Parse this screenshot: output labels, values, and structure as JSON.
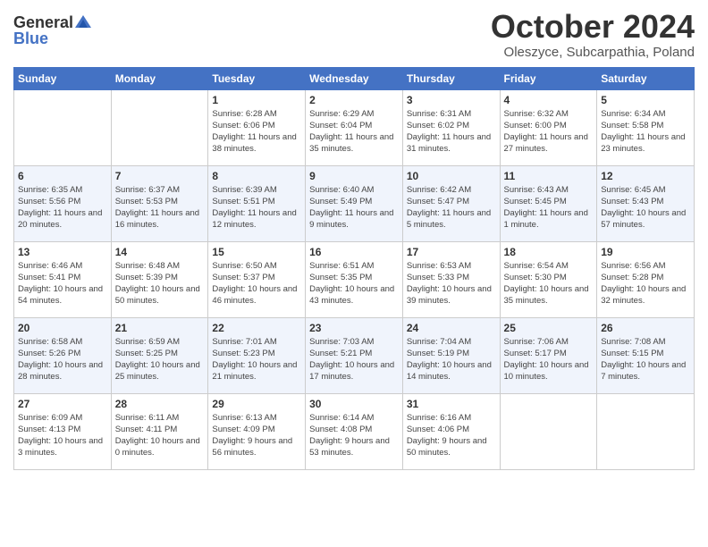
{
  "header": {
    "logo_general": "General",
    "logo_blue": "Blue",
    "month": "October 2024",
    "location": "Oleszyce, Subcarpathia, Poland"
  },
  "days_of_week": [
    "Sunday",
    "Monday",
    "Tuesday",
    "Wednesday",
    "Thursday",
    "Friday",
    "Saturday"
  ],
  "weeks": [
    [
      {
        "day": "",
        "info": ""
      },
      {
        "day": "",
        "info": ""
      },
      {
        "day": "1",
        "info": "Sunrise: 6:28 AM\nSunset: 6:06 PM\nDaylight: 11 hours and 38 minutes."
      },
      {
        "day": "2",
        "info": "Sunrise: 6:29 AM\nSunset: 6:04 PM\nDaylight: 11 hours and 35 minutes."
      },
      {
        "day": "3",
        "info": "Sunrise: 6:31 AM\nSunset: 6:02 PM\nDaylight: 11 hours and 31 minutes."
      },
      {
        "day": "4",
        "info": "Sunrise: 6:32 AM\nSunset: 6:00 PM\nDaylight: 11 hours and 27 minutes."
      },
      {
        "day": "5",
        "info": "Sunrise: 6:34 AM\nSunset: 5:58 PM\nDaylight: 11 hours and 23 minutes."
      }
    ],
    [
      {
        "day": "6",
        "info": "Sunrise: 6:35 AM\nSunset: 5:56 PM\nDaylight: 11 hours and 20 minutes."
      },
      {
        "day": "7",
        "info": "Sunrise: 6:37 AM\nSunset: 5:53 PM\nDaylight: 11 hours and 16 minutes."
      },
      {
        "day": "8",
        "info": "Sunrise: 6:39 AM\nSunset: 5:51 PM\nDaylight: 11 hours and 12 minutes."
      },
      {
        "day": "9",
        "info": "Sunrise: 6:40 AM\nSunset: 5:49 PM\nDaylight: 11 hours and 9 minutes."
      },
      {
        "day": "10",
        "info": "Sunrise: 6:42 AM\nSunset: 5:47 PM\nDaylight: 11 hours and 5 minutes."
      },
      {
        "day": "11",
        "info": "Sunrise: 6:43 AM\nSunset: 5:45 PM\nDaylight: 11 hours and 1 minute."
      },
      {
        "day": "12",
        "info": "Sunrise: 6:45 AM\nSunset: 5:43 PM\nDaylight: 10 hours and 57 minutes."
      }
    ],
    [
      {
        "day": "13",
        "info": "Sunrise: 6:46 AM\nSunset: 5:41 PM\nDaylight: 10 hours and 54 minutes."
      },
      {
        "day": "14",
        "info": "Sunrise: 6:48 AM\nSunset: 5:39 PM\nDaylight: 10 hours and 50 minutes."
      },
      {
        "day": "15",
        "info": "Sunrise: 6:50 AM\nSunset: 5:37 PM\nDaylight: 10 hours and 46 minutes."
      },
      {
        "day": "16",
        "info": "Sunrise: 6:51 AM\nSunset: 5:35 PM\nDaylight: 10 hours and 43 minutes."
      },
      {
        "day": "17",
        "info": "Sunrise: 6:53 AM\nSunset: 5:33 PM\nDaylight: 10 hours and 39 minutes."
      },
      {
        "day": "18",
        "info": "Sunrise: 6:54 AM\nSunset: 5:30 PM\nDaylight: 10 hours and 35 minutes."
      },
      {
        "day": "19",
        "info": "Sunrise: 6:56 AM\nSunset: 5:28 PM\nDaylight: 10 hours and 32 minutes."
      }
    ],
    [
      {
        "day": "20",
        "info": "Sunrise: 6:58 AM\nSunset: 5:26 PM\nDaylight: 10 hours and 28 minutes."
      },
      {
        "day": "21",
        "info": "Sunrise: 6:59 AM\nSunset: 5:25 PM\nDaylight: 10 hours and 25 minutes."
      },
      {
        "day": "22",
        "info": "Sunrise: 7:01 AM\nSunset: 5:23 PM\nDaylight: 10 hours and 21 minutes."
      },
      {
        "day": "23",
        "info": "Sunrise: 7:03 AM\nSunset: 5:21 PM\nDaylight: 10 hours and 17 minutes."
      },
      {
        "day": "24",
        "info": "Sunrise: 7:04 AM\nSunset: 5:19 PM\nDaylight: 10 hours and 14 minutes."
      },
      {
        "day": "25",
        "info": "Sunrise: 7:06 AM\nSunset: 5:17 PM\nDaylight: 10 hours and 10 minutes."
      },
      {
        "day": "26",
        "info": "Sunrise: 7:08 AM\nSunset: 5:15 PM\nDaylight: 10 hours and 7 minutes."
      }
    ],
    [
      {
        "day": "27",
        "info": "Sunrise: 6:09 AM\nSunset: 4:13 PM\nDaylight: 10 hours and 3 minutes."
      },
      {
        "day": "28",
        "info": "Sunrise: 6:11 AM\nSunset: 4:11 PM\nDaylight: 10 hours and 0 minutes."
      },
      {
        "day": "29",
        "info": "Sunrise: 6:13 AM\nSunset: 4:09 PM\nDaylight: 9 hours and 56 minutes."
      },
      {
        "day": "30",
        "info": "Sunrise: 6:14 AM\nSunset: 4:08 PM\nDaylight: 9 hours and 53 minutes."
      },
      {
        "day": "31",
        "info": "Sunrise: 6:16 AM\nSunset: 4:06 PM\nDaylight: 9 hours and 50 minutes."
      },
      {
        "day": "",
        "info": ""
      },
      {
        "day": "",
        "info": ""
      }
    ]
  ]
}
